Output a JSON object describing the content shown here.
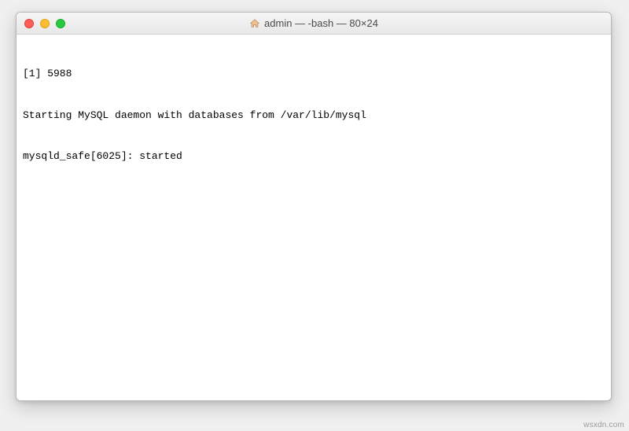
{
  "window": {
    "title": "admin — -bash — 80×24"
  },
  "terminal": {
    "lines": [
      "[1] 5988",
      "Starting MySQL daemon with databases from /var/lib/mysql",
      "mysqld_safe[6025]: started"
    ]
  },
  "watermark": "wsxdn.com"
}
